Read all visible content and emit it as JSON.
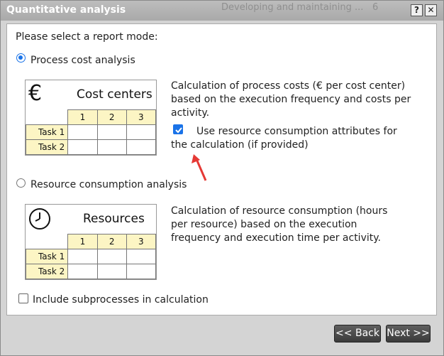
{
  "window": {
    "title": "Quantitative analysis",
    "background_title": "Developing and maintaining ...",
    "background_count": "6",
    "help_label": "?",
    "close_label": "✕"
  },
  "prompt": "Please select a report mode:",
  "options": {
    "process_cost": {
      "label": "Process cost analysis",
      "selected": true,
      "card_title": "Cost centers",
      "card_icon": "euro-icon",
      "description": "Calculation of process costs (€ per cost center) based on the execution frequency and costs per activity.",
      "checkbox_label": "Use resource consumption attributes for the calculation (if provided)",
      "checkbox_checked": true
    },
    "resource_consumption": {
      "label": "Resource consumption analysis",
      "selected": false,
      "card_title": "Resources",
      "card_icon": "clock-icon",
      "description": "Calculation of resource consumption (hours per resource) based on the execution frequency and execution time per activity."
    }
  },
  "table": {
    "columns": [
      "1",
      "2",
      "3"
    ],
    "rows": [
      "Task 1",
      "Task 2"
    ]
  },
  "subprocesses": {
    "label": "Include subprocesses in calculation",
    "checked": false
  },
  "buttons": {
    "back": "<< Back",
    "next": "Next >>"
  },
  "colors": {
    "accent": "#1a73e8",
    "table_header": "#fcf5c4",
    "annotation_arrow": "#e53935"
  }
}
